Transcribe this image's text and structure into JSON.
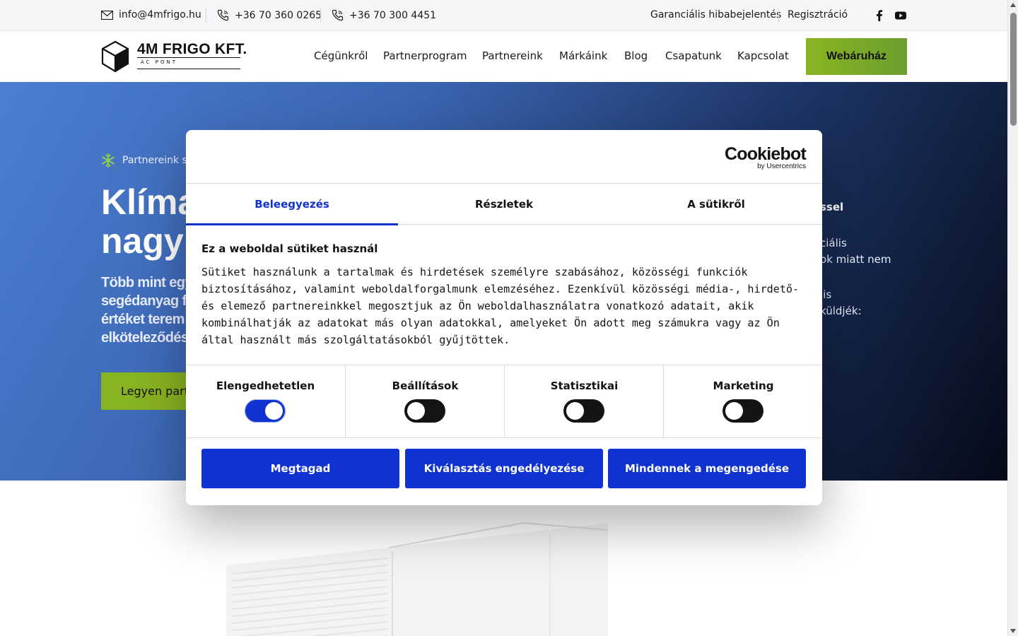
{
  "topbar": {
    "email": "info@4mfrigo.hu",
    "phone1": "+36 70 360 0265",
    "phone2": "+36 70 300 4451",
    "warranty_link": "Garanciális hibabejelentés",
    "register_link": "Regisztráció",
    "social_icons": [
      "facebook-icon",
      "youtube-icon"
    ]
  },
  "header": {
    "logo_title": "4M FRIGO KFT.",
    "logo_subtitle": "AC PONT",
    "nav": [
      "Cégünkről",
      "Partnerprogram",
      "Partnereink",
      "Márkáink",
      "Blog",
      "Csapatunk",
      "Kapcsolat"
    ],
    "shop_button": "Webáruház"
  },
  "hero": {
    "kicker": "Partnereink s",
    "title_line1": "Klíma",
    "title_line2": "nagy",
    "subtitle_lines": [
      "Több mint egy",
      "segédanyag f",
      "értéket terem",
      "elköteleződés"
    ],
    "button": "Legyen partn",
    "right_title": "ssel",
    "right_lines": [
      "ciális",
      "ok miatt nem",
      "lis",
      "küldjék:"
    ]
  },
  "cookie_dialog": {
    "logo_big": "Cookiebot",
    "logo_small": "by Usercentrics",
    "tabs": [
      "Beleegyezés",
      "Részletek",
      "A sütikről"
    ],
    "active_tab": "Beleegyezés",
    "title": "Ez a weboldal sütiket használ",
    "text": "Sütiket használunk a tartalmak és hirdetések személyre szabásához, közösségi funkciók biztosításához, valamint weboldalforgalmunk elemzéséhez. Ezenkívül közösségi média-, hirdető- és elemező partnereinkkel megosztjuk az Ön weboldalhasználatra vonatkozó adatait, akik kombinálhatják az adatokat más olyan adatokkal, amelyeket Ön adott meg számukra vagy az Ön által használt más szolgáltatásokból gyűjtöttek.",
    "toggles": [
      {
        "label": "Elengedhetetlen",
        "on": true
      },
      {
        "label": "Beállítások",
        "on": false
      },
      {
        "label": "Statisztikai",
        "on": false
      },
      {
        "label": "Marketing",
        "on": false
      }
    ],
    "buttons": [
      "Megtagad",
      "Kiválasztás engedélyezése",
      "Mindennek a megengedése"
    ]
  },
  "colors": {
    "accent_blue": "#1032cf",
    "brand_green": "#88b322",
    "hero_blue": "#3a64b0"
  }
}
